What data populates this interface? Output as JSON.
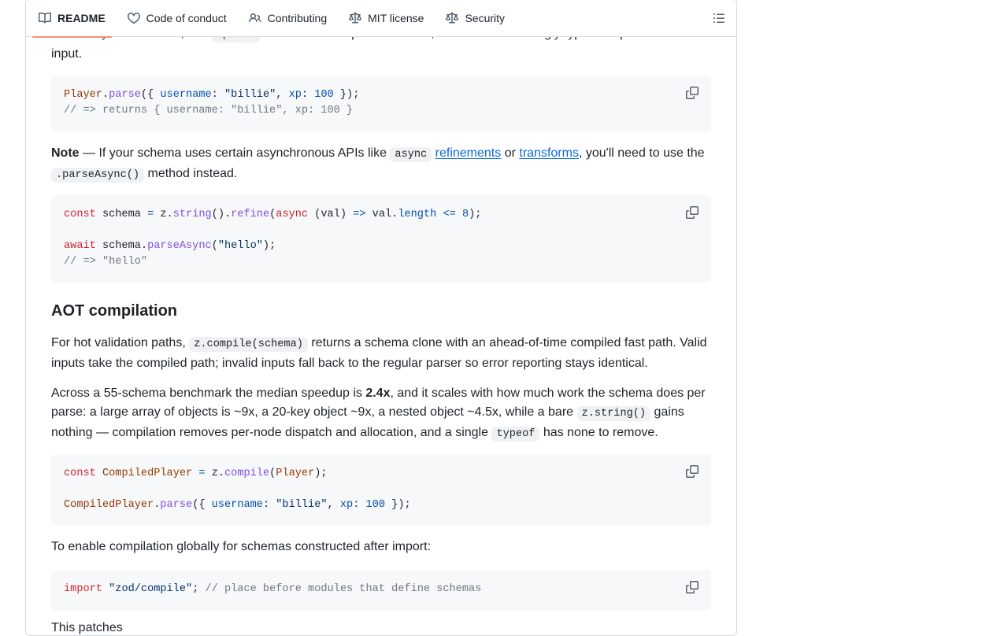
{
  "tabs": [
    {
      "label": "README",
      "icon": "book-icon",
      "active": true
    },
    {
      "label": "Code of conduct",
      "icon": "heart-icon",
      "active": false
    },
    {
      "label": "Contributing",
      "icon": "people-icon",
      "active": false
    },
    {
      "label": "MIT license",
      "icon": "law-icon",
      "active": false
    },
    {
      "label": "Security",
      "icon": "law-icon",
      "active": false
    }
  ],
  "intro": {
    "text_1": "Given any Zod schema, use ",
    "code": ".parse",
    "text_2": " to validate an input. If it's valid, Zod returns a strongly-typed deep clone of the input."
  },
  "code1": {
    "line1": {
      "a": "Player",
      "b": ".",
      "c": "parse",
      "d": "({ ",
      "e": "username",
      "f": ": ",
      "g": "\"billie\"",
      "h": ", ",
      "i": "xp",
      "j": ": ",
      "k": "100",
      "l": " });"
    },
    "line2": "// => returns { username: \"billie\", xp: 100 }"
  },
  "note": {
    "bold": "Note",
    "text_1": " — If your schema uses certain asynchronous APIs like ",
    "code_async": "async",
    "link_refinements": "refinements",
    "text_or": " or ",
    "link_transforms": "transforms",
    "text_2": ", you'll need to use the ",
    "code_parse_async": ".parseAsync()",
    "text_3": " method instead."
  },
  "code2": {
    "l1": {
      "kw": "const",
      "a": " schema ",
      "op": "=",
      "b": " z.",
      "fn1": "string",
      "c": "().",
      "fn2": "refine",
      "d": "(",
      "kw2": "async",
      "e": " (val) ",
      "arrow": "=>",
      "f": " val.",
      "prop": "length",
      "g": " ",
      "le": "<=",
      "h": " ",
      "num": "8",
      "i": ");"
    },
    "l3": {
      "kw": "await",
      "a": " schema.",
      "fn": "parseAsync",
      "b": "(",
      "str": "\"hello\"",
      "c": ");"
    },
    "l4": "// => \"hello\""
  },
  "aot": {
    "heading": "AOT compilation",
    "p1_text_1": "For hot validation paths, ",
    "p1_code": "z.compile(schema)",
    "p1_text_2": " returns a schema clone with an ahead-of-time compiled fast path. Valid inputs take the compiled path; invalid inputs fall back to the regular parser so error reporting stays identical.",
    "p2_text_1": "Across a 55-schema benchmark the median speedup is ",
    "p2_bold": "2.4x",
    "p2_text_2": ", and it scales with how much work the schema does per parse: a large array of objects is ~9x, a 20-key object ~9x, a nested object ~4.5x, while a bare ",
    "p2_code_string": "z.string()",
    "p2_text_3": " gains nothing — compilation removes per-node dispatch and allocation, and a single ",
    "p2_code_typeof": "typeof",
    "p2_text_4": " has none to remove."
  },
  "code3": {
    "l1": {
      "kw": "const",
      "a": " ",
      "cls": "CompiledPlayer",
      "b": " ",
      "op": "=",
      "c": " z.",
      "fn": "compile",
      "d": "(",
      "cls2": "Player",
      "e": ");"
    },
    "l3": {
      "cls": "CompiledPlayer",
      "a": ".",
      "fn": "parse",
      "b": "({ ",
      "prop1": "username",
      "c": ": ",
      "str": "\"billie\"",
      "d": ", ",
      "prop2": "xp",
      "e": ": ",
      "num": "100",
      "f": " });"
    }
  },
  "global": {
    "text": "To enable compilation globally for schemas constructed after import:"
  },
  "code4": {
    "kw": "import",
    "a": " ",
    "str": "\"zod/compile\"",
    "b": "; ",
    "com": "// place before modules that define schemas"
  },
  "trailing": {
    "text": "This patches"
  }
}
